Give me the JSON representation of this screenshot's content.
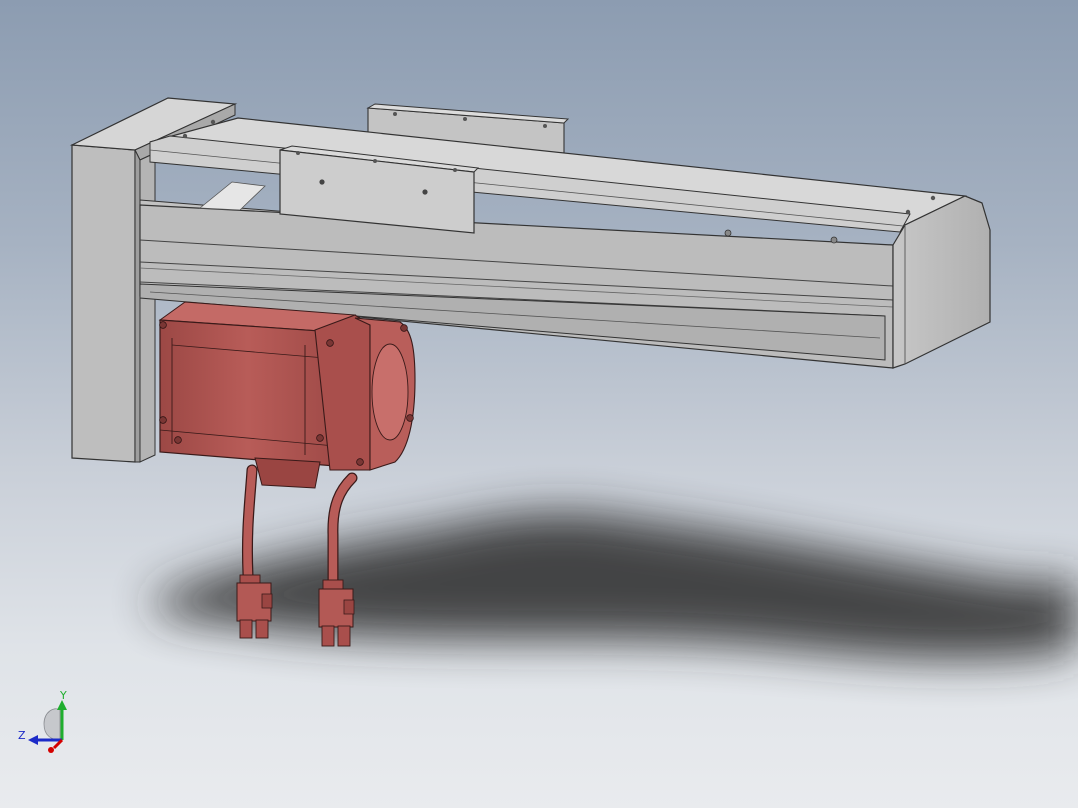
{
  "viewport": {
    "background_top": "#8c9cb1",
    "background_bottom": "#e9ebee"
  },
  "model": {
    "actuator_color": "#c9c9c9",
    "motor_color": "#b55a57",
    "shadow_color": "#2c2c2c"
  },
  "triad": {
    "y_label": "Y",
    "z_label": "Z",
    "x_color": "#d40000",
    "y_color": "#1fae2e",
    "z_color": "#1c2bc8"
  }
}
